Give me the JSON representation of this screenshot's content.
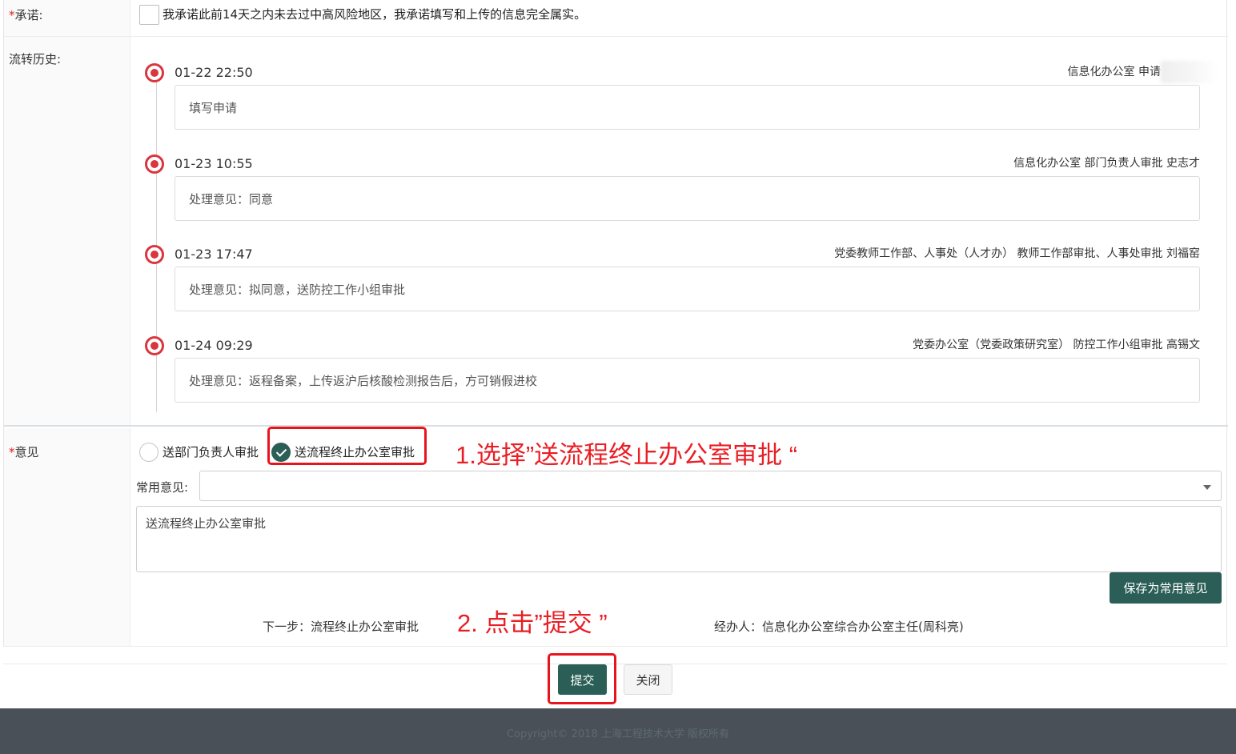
{
  "colors": {
    "accent": "#2a5e56",
    "timeline_dot": "#d9363e",
    "annotation": "#ea1e25",
    "footer_bg": "#4a5057"
  },
  "promise": {
    "required_mark": "*",
    "label": "承诺:",
    "text": "我承诺此前14天之内未去过中高风险地区，我承诺填写和上传的信息完全属实。",
    "checked": false
  },
  "history": {
    "label": "流转历史:",
    "items": [
      {
        "time": "01-22 22:50",
        "who": "信息化办公室 申请",
        "comment": "填写申请"
      },
      {
        "time": "01-23 10:55",
        "who": "信息化办公室 部门负责人审批 史志才",
        "comment": "处理意见：同意"
      },
      {
        "time": "01-23 17:47",
        "who": "党委教师工作部、人事处（人才办） 教师工作部审批、人事处审批 刘福窑",
        "comment": "处理意见：拟同意，送防控工作小组审批"
      },
      {
        "time": "01-24 09:29",
        "who": "党委办公室（党委政策研究室） 防控工作小组审批 高锡文",
        "comment": "处理意见：返程备案，上传返沪后核酸检测报告后，方可销假进校"
      }
    ]
  },
  "opinion": {
    "required_mark": "*",
    "label": "意见",
    "options": [
      {
        "label": "送部门负责人审批",
        "selected": false
      },
      {
        "label": "送流程终止办公室审批",
        "selected": true
      }
    ],
    "common_label": "常用意见:",
    "common_value": "",
    "text": "送流程终止办公室审批",
    "save_button": "保存为常用意见",
    "next_step": "下一步：流程终止办公室审批",
    "handler": "经办人：信息化办公室综合办公室主任(周科亮)"
  },
  "annotations": {
    "step1": "1.选择”送流程终止办公室审批 “",
    "step2": "2. 点击”提交 ”"
  },
  "actions": {
    "submit": "提交",
    "close": "关闭"
  },
  "footer": {
    "copyright": "Copyright© 2018 上海工程技术大学 版权所有"
  }
}
